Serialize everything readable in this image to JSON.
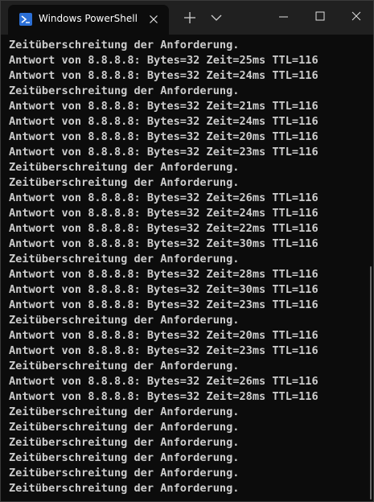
{
  "tab": {
    "title": "Windows PowerShell",
    "icon": "powershell-icon"
  },
  "titlebar": {
    "new_tab_icon": "plus-icon",
    "dropdown_icon": "chevron-down-icon",
    "minimize_icon": "minimize-icon",
    "maximize_icon": "maximize-icon",
    "close_icon": "close-icon"
  },
  "colors": {
    "background": "#0c0c0c",
    "titlebar": "#202020",
    "text": "#cccccc",
    "accent": "#2b6fd6"
  },
  "terminal": {
    "lines": [
      "Zeitüberschreitung der Anforderung.",
      "Antwort von 8.8.8.8: Bytes=32 Zeit=25ms TTL=116",
      "Antwort von 8.8.8.8: Bytes=32 Zeit=24ms TTL=116",
      "Zeitüberschreitung der Anforderung.",
      "Antwort von 8.8.8.8: Bytes=32 Zeit=21ms TTL=116",
      "Antwort von 8.8.8.8: Bytes=32 Zeit=24ms TTL=116",
      "Antwort von 8.8.8.8: Bytes=32 Zeit=20ms TTL=116",
      "Antwort von 8.8.8.8: Bytes=32 Zeit=23ms TTL=116",
      "Zeitüberschreitung der Anforderung.",
      "Zeitüberschreitung der Anforderung.",
      "Antwort von 8.8.8.8: Bytes=32 Zeit=26ms TTL=116",
      "Antwort von 8.8.8.8: Bytes=32 Zeit=24ms TTL=116",
      "Antwort von 8.8.8.8: Bytes=32 Zeit=22ms TTL=116",
      "Antwort von 8.8.8.8: Bytes=32 Zeit=30ms TTL=116",
      "Zeitüberschreitung der Anforderung.",
      "Antwort von 8.8.8.8: Bytes=32 Zeit=28ms TTL=116",
      "Antwort von 8.8.8.8: Bytes=32 Zeit=30ms TTL=116",
      "Antwort von 8.8.8.8: Bytes=32 Zeit=23ms TTL=116",
      "Zeitüberschreitung der Anforderung.",
      "Antwort von 8.8.8.8: Bytes=32 Zeit=20ms TTL=116",
      "Antwort von 8.8.8.8: Bytes=32 Zeit=23ms TTL=116",
      "Zeitüberschreitung der Anforderung.",
      "Antwort von 8.8.8.8: Bytes=32 Zeit=26ms TTL=116",
      "Antwort von 8.8.8.8: Bytes=32 Zeit=28ms TTL=116",
      "Zeitüberschreitung der Anforderung.",
      "Zeitüberschreitung der Anforderung.",
      "Zeitüberschreitung der Anforderung.",
      "Zeitüberschreitung der Anforderung.",
      "Zeitüberschreitung der Anforderung.",
      "Zeitüberschreitung der Anforderung."
    ]
  }
}
